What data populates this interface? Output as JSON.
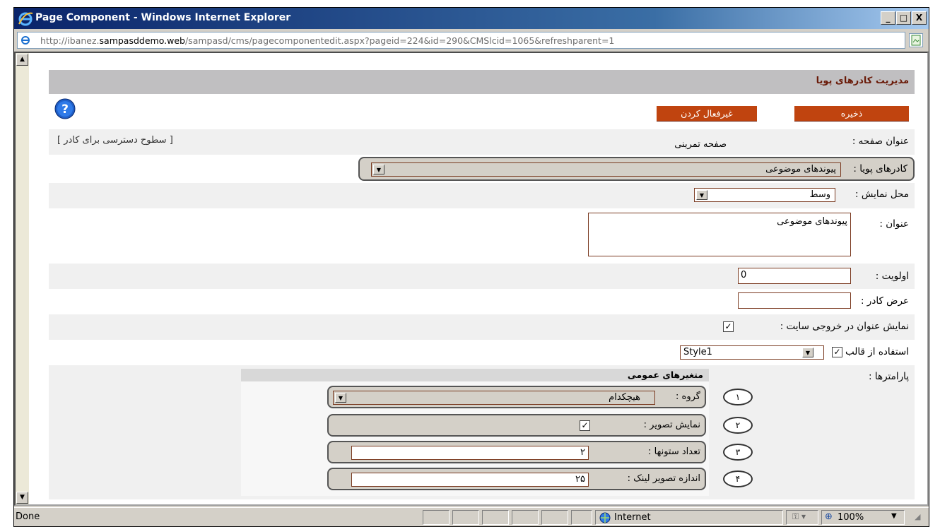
{
  "window": {
    "title": "Page Component - Windows Internet Explorer",
    "minimize": "_",
    "maximize": "□",
    "close": "X"
  },
  "address": {
    "url_prefix": "http://ibanez.",
    "url_host": "sampasddemo.web",
    "url_rest": "/sampasd/cms/pagecomponentedit.aspx?pageid=224&id=290&CMSlcid=1065&refreshparent=1"
  },
  "page": {
    "header_title": "مدیریت کادرهای پویا",
    "save_button": "ذخیره",
    "deactivate_button": "غیرفعال کردن",
    "access_levels_link": "[ سطوح دسترسی برای کادر ]",
    "fields": {
      "page_title_label": "عنوان صفحه :",
      "page_title_value": "صفحه تمرینی",
      "dynamic_frames_label": "کادرهای پویا :",
      "dynamic_frames_value": "پیوندهای موضوعی",
      "display_location_label": "محل نمایش :",
      "display_location_value": "وسط",
      "title_label": "عنوان :",
      "title_value": "پیوندهای موضوعی",
      "priority_label": "اولویت :",
      "priority_value": "0",
      "frame_width_label": "عرض کادر :",
      "frame_width_value": "",
      "show_title_label": "نمایش عنوان در خروجی سایت :",
      "show_title_checked": true,
      "use_template_label": "استفاده از قالب :",
      "use_template_checked": true,
      "template_value": "Style1",
      "parameters_label": "پارامترها :"
    },
    "params": {
      "header": "متغیرهای عمومی",
      "rows": [
        {
          "num": "۱",
          "label": "گروه :",
          "value": "هیچکدام"
        },
        {
          "num": "۲",
          "label": "نمایش تصویر :",
          "value": ""
        },
        {
          "num": "۳",
          "label": "تعداد ستونها :",
          "value": "۲"
        },
        {
          "num": "۴",
          "label": "اندازه تصویر لینک :",
          "value": "۲۵"
        }
      ]
    }
  },
  "status": {
    "text": "Done",
    "zone": "Internet",
    "zoom": "100%"
  },
  "colors": {
    "accent_button": "#c0440f",
    "title_bar": "#0a246a",
    "header_text": "#6a1a08"
  }
}
